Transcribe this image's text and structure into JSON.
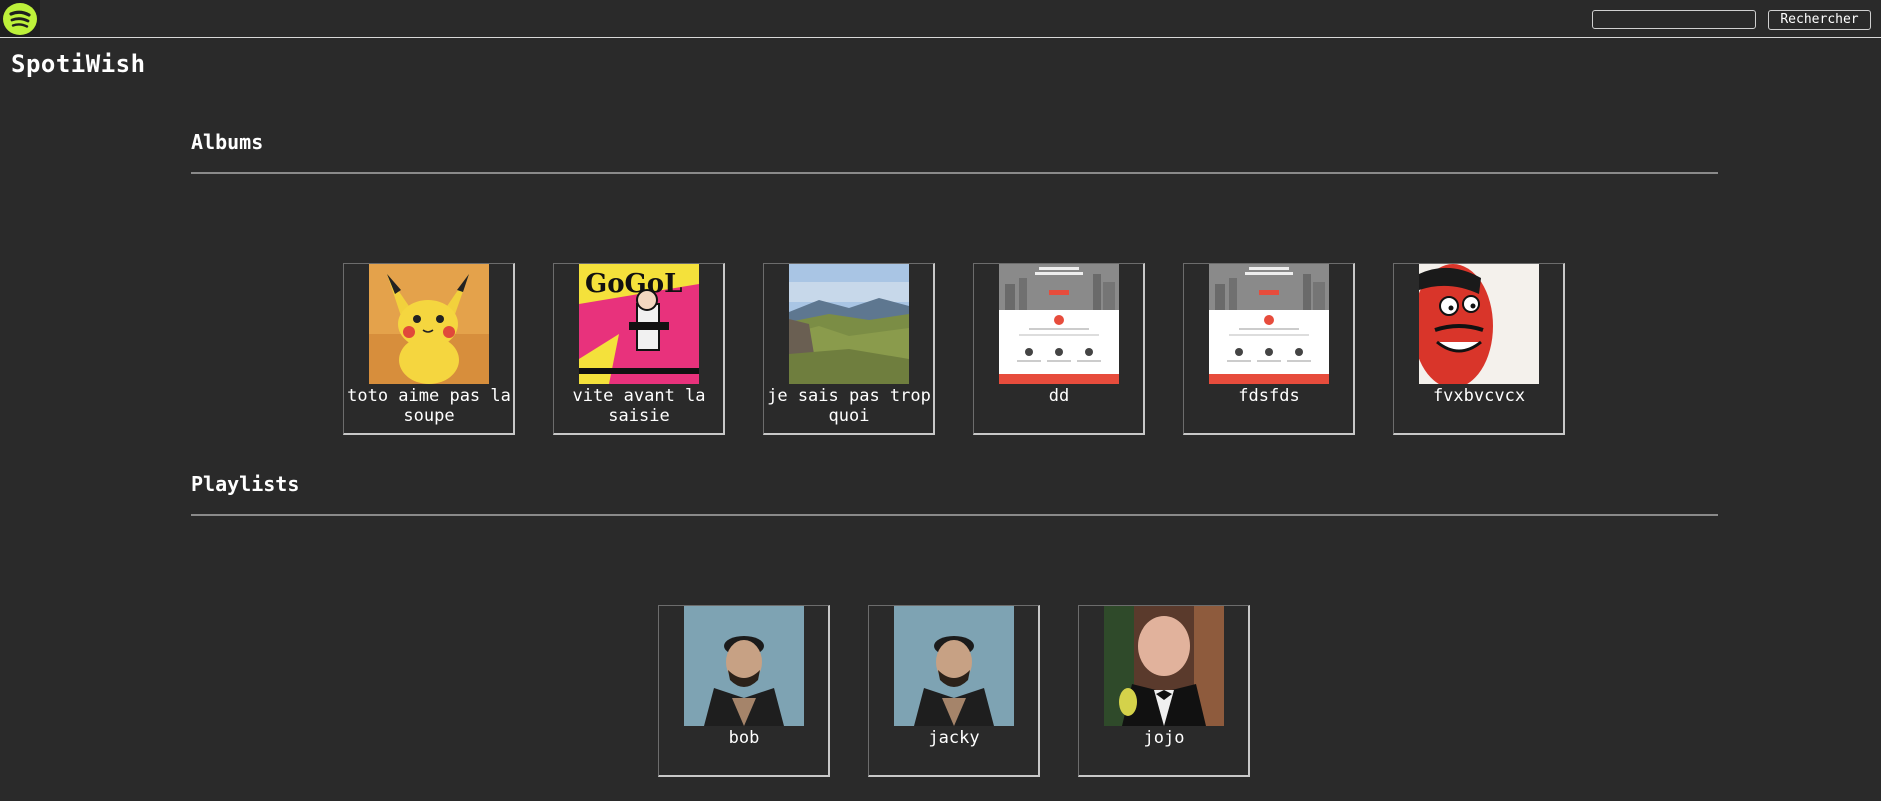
{
  "header": {
    "logo_icon": "spotify-logo-icon",
    "search_placeholder": "",
    "search_value": "",
    "search_button_label": "Rechercher"
  },
  "app_title": "SpotiWish",
  "albums": {
    "title": "Albums",
    "items": [
      {
        "label": "toto aime pas la soupe",
        "image": "pikachu-cover"
      },
      {
        "label": "vite avant la saisie",
        "image": "gogol-comic-cover"
      },
      {
        "label": "je sais pas trop quoi",
        "image": "mountain-landscape-cover"
      },
      {
        "label": "dd",
        "image": "website-screenshot-cover"
      },
      {
        "label": "fdsfds",
        "image": "website-screenshot-cover"
      },
      {
        "label": "fvxbvcvcx",
        "image": "cabu-beauf-cover"
      }
    ]
  },
  "playlists": {
    "title": "Playlists",
    "items": [
      {
        "label": "bob",
        "image": "biker-portrait-cover"
      },
      {
        "label": "jacky",
        "image": "biker-portrait-cover"
      },
      {
        "label": "jojo",
        "image": "man-in-tuxedo-cover"
      }
    ]
  },
  "colors": {
    "background": "#2a2a2a",
    "logo_accent": "#bdf13a",
    "rule": "#8a8a8a"
  }
}
